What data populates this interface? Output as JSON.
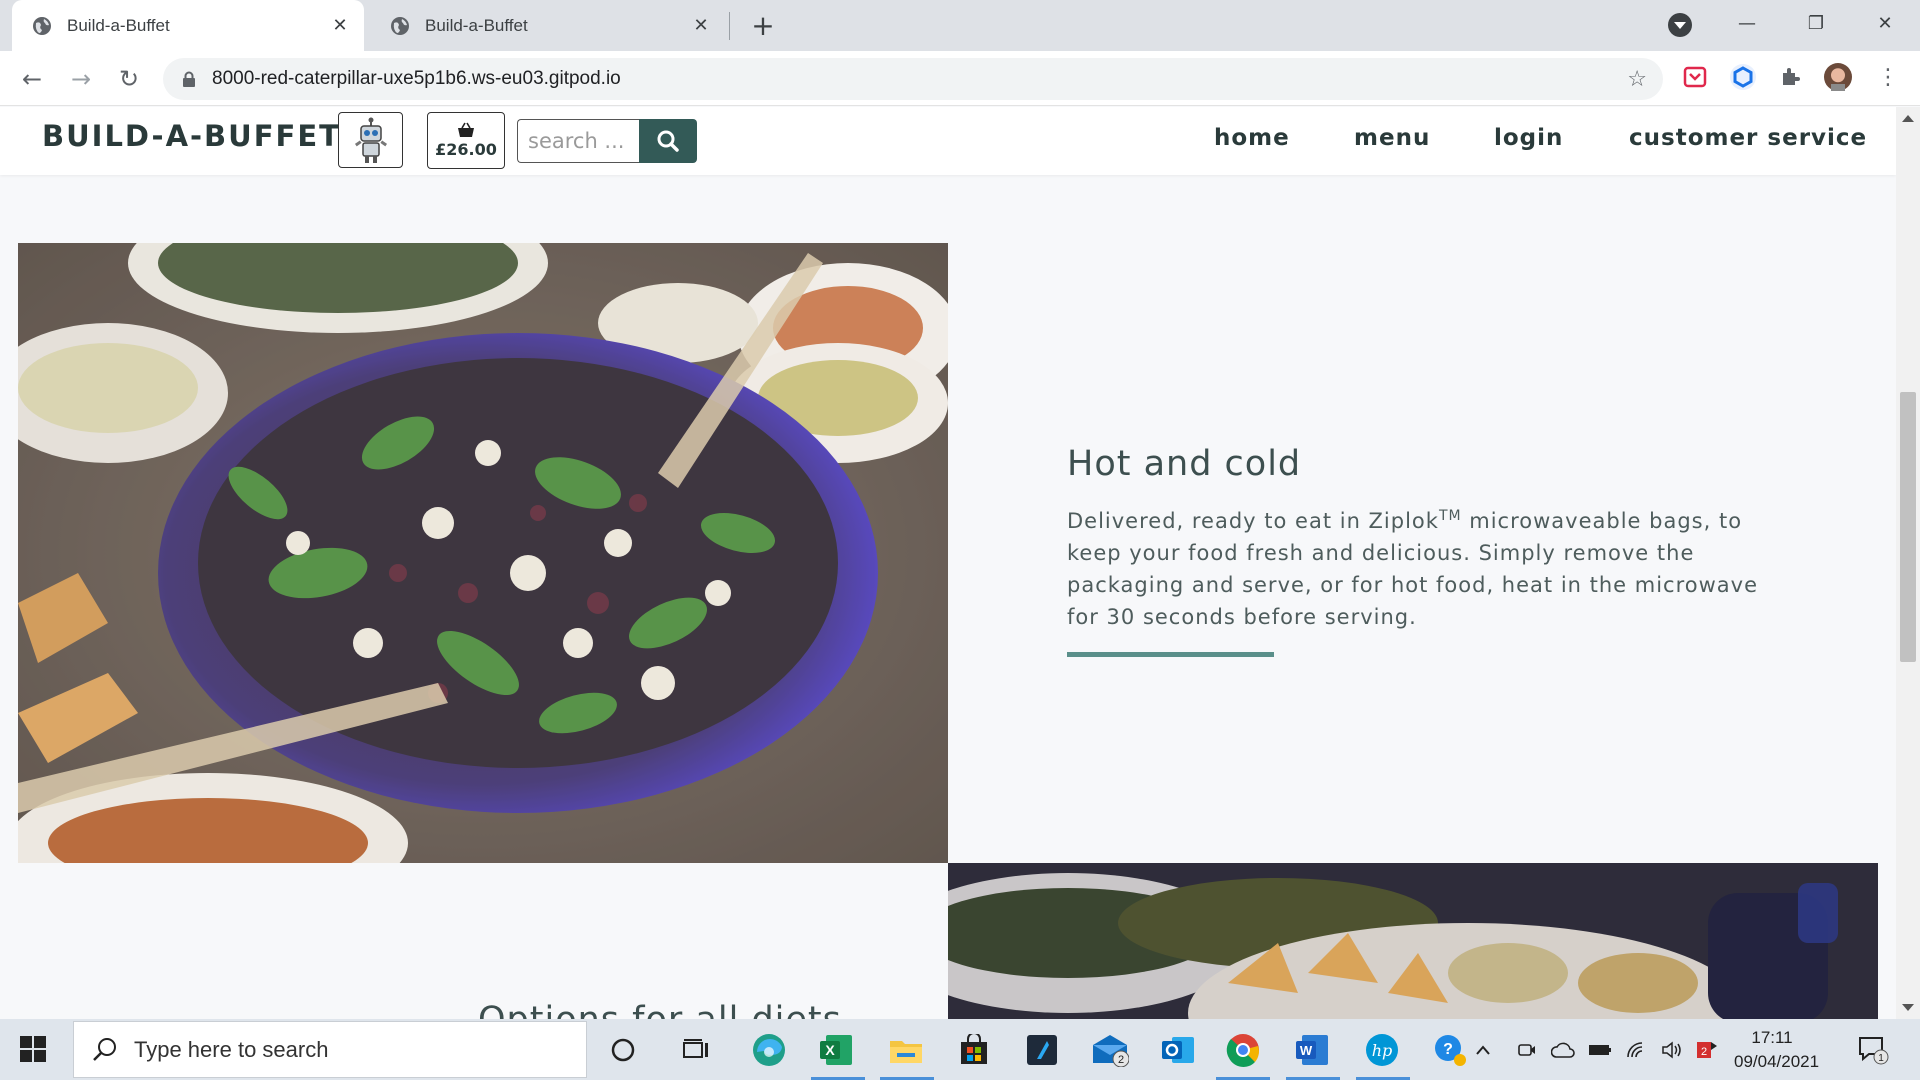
{
  "browser": {
    "tabs": [
      {
        "title": "Build-a-Buffet",
        "active": true
      },
      {
        "title": "Build-a-Buffet",
        "active": false
      }
    ],
    "new_tab_symbol": "+",
    "url": "8000-red-caterpillar-uxe5p1b6.ws-eu03.gitpod.io"
  },
  "site": {
    "brand": "BUILD-A-BUFFET",
    "basket_total": "£26.00",
    "search_placeholder": "search ...",
    "menu": [
      "home",
      "menu",
      "login",
      "customer service"
    ]
  },
  "feature": {
    "title": "Hot and cold",
    "text_before_tm": "Delivered, ready to eat in Ziplok",
    "tm": "TM",
    "text_after_tm": " microwaveable bags, to keep your food fresh and delicious. Simply remove the packaging and serve, or for hot food, heat in the microwave for 30 seconds before serving."
  },
  "second_feature": {
    "title": "Options for all diets"
  },
  "taskbar": {
    "search_placeholder": "Type here to search",
    "time": "17:11",
    "date": "09/04/2021",
    "mail_badge": "2",
    "notification_badge": "1"
  },
  "colors": {
    "accent": "#335a57",
    "rule": "#5a8f8a",
    "page_bg": "#f7f8fa"
  }
}
